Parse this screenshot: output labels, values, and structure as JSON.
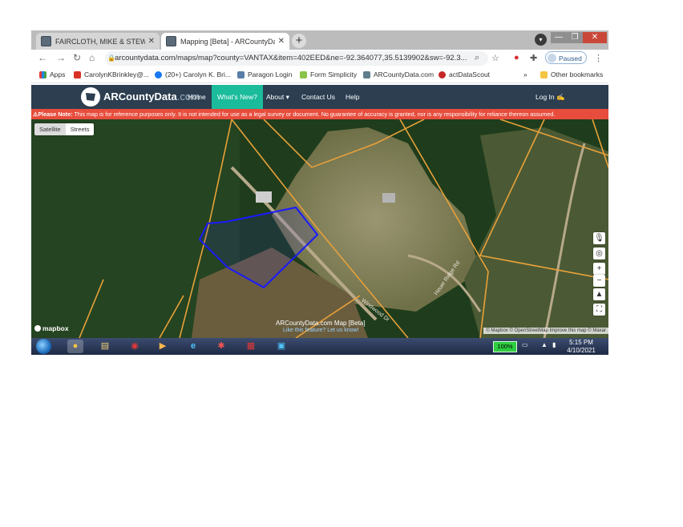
{
  "browser": {
    "tabs": [
      {
        "title": "FAIRCLOTH, MIKE & STEWART, S",
        "close": "✕"
      },
      {
        "title": "Mapping [Beta] - ARCountyData",
        "close": "✕"
      }
    ],
    "new_tab": "+",
    "window_controls": {
      "minimize": "—",
      "maximize": "❐",
      "close": "✕"
    },
    "url": "arcountydata.com/maps/map?county=VANTAX&item=402EED&ne=-92.364077,35.5139902&sw=-92.3...",
    "profile_status": "Paused",
    "bookmarks": [
      {
        "label": "Apps",
        "icon": "apps-grid-icon"
      },
      {
        "label": "CarolynKBrinkley@...",
        "icon": "gmail-icon"
      },
      {
        "label": "(20+) Carolyn K. Bri...",
        "icon": "facebook-icon"
      },
      {
        "label": "Paragon Login",
        "icon": "paragon-icon"
      },
      {
        "label": "Form Simplicity",
        "icon": "document-icon"
      },
      {
        "label": "ARCountyData.com",
        "icon": "arcounty-icon"
      },
      {
        "label": "actDataScout",
        "icon": "datascout-icon"
      }
    ],
    "more_bookmarks": "»",
    "other_bookmarks": "Other bookmarks"
  },
  "site": {
    "logo_main": "ARCounty",
    "logo_accent": "Data",
    "logo_suffix": ".com",
    "nav": [
      {
        "label": "Home",
        "active": false
      },
      {
        "label": "What's New?",
        "active": true
      },
      {
        "label": "About ▾",
        "active": false
      },
      {
        "label": "Contact Us",
        "active": false
      },
      {
        "label": "Help",
        "active": false
      }
    ],
    "login": "Log In ✍",
    "notice_label": "⚠Please Note:",
    "notice_text": " This map is for reference purposes only. It is not intended for use as a legal survey or document. No guarantee of accuracy is granted, nor is any responsibility for reliance thereon assumed."
  },
  "map": {
    "toggle": {
      "satellite": "Satellite",
      "streets": "Streets"
    },
    "controls": {
      "mic": "🎙",
      "locate": "◎",
      "zoom_in": "+",
      "zoom_out": "−",
      "compass": "▲",
      "fullscreen": "⛶"
    },
    "road_labels": [
      "Windwood Dr",
      "Heuer Ridge Rd"
    ],
    "mapbox": "mapbox",
    "title": "ARCountyData.com Map [Beta]",
    "subtitle": "Like this feature? Let us know!",
    "attribution": "© Mapbox © OpenStreetMap  Improve this map  © Maxar",
    "colors": {
      "parcel_line": "#e8a13a",
      "selected_parcel": "#1a1aff"
    }
  },
  "taskbar": {
    "apps": [
      {
        "name": "chrome",
        "glyph": "●",
        "active": true
      },
      {
        "name": "file-explorer",
        "glyph": "▤",
        "active": false
      },
      {
        "name": "app-red",
        "glyph": "◉",
        "active": false
      },
      {
        "name": "media-player",
        "glyph": "▶",
        "active": false
      },
      {
        "name": "internet-explorer",
        "glyph": "e",
        "active": false
      },
      {
        "name": "app-burst",
        "glyph": "✱",
        "active": false
      },
      {
        "name": "app-cart",
        "glyph": "▦",
        "active": false
      },
      {
        "name": "app-briefcase",
        "glyph": "▣",
        "active": false
      }
    ],
    "battery": "100%",
    "time": "5:15 PM",
    "date": "4/10/2021"
  }
}
